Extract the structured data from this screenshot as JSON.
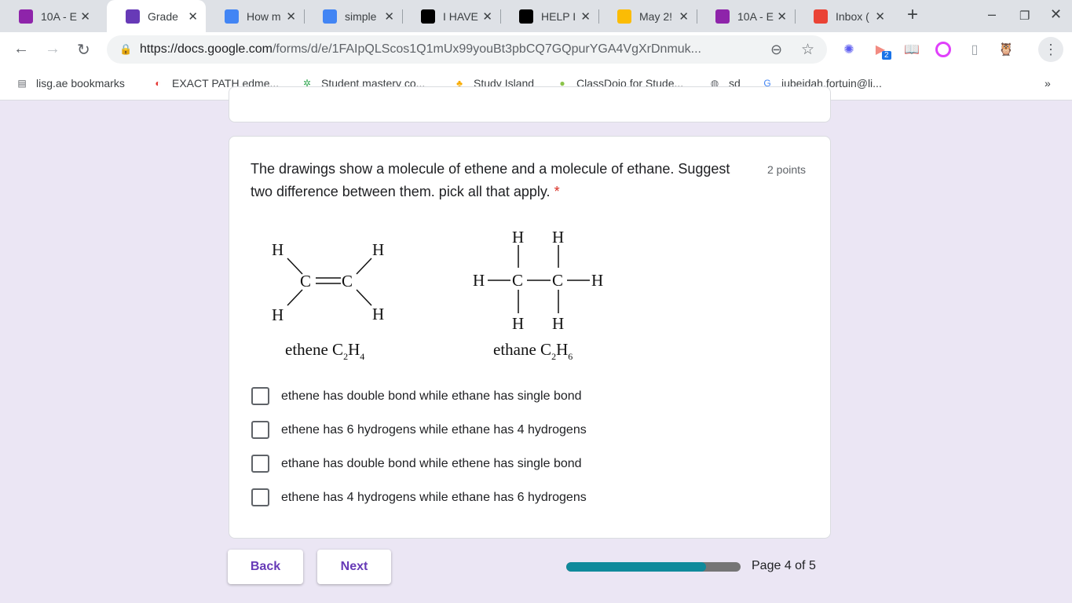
{
  "tabs": [
    {
      "title": "10A - E",
      "icon": "classroom-icon",
      "color": "#8e24aa"
    },
    {
      "title": "Grade",
      "icon": "forms-icon",
      "color": "#673ab7",
      "active": true
    },
    {
      "title": "How m",
      "icon": "google-icon",
      "color": "#4285f4"
    },
    {
      "title": "simple",
      "icon": "google-icon",
      "color": "#4285f4"
    },
    {
      "title": "I HAVE",
      "icon": "brainly-icon",
      "color": "#000000"
    },
    {
      "title": "HELP I",
      "icon": "brainly-icon",
      "color": "#000000"
    },
    {
      "title": "May 2!",
      "icon": "drive-icon",
      "color": "#fbbc04"
    },
    {
      "title": "10A - E",
      "icon": "classroom-icon",
      "color": "#8e24aa"
    },
    {
      "title": "Inbox (",
      "icon": "gmail-icon",
      "color": "#ea4335"
    }
  ],
  "url": {
    "host": "https://docs.google.com",
    "path": "/forms/d/e/1FAIpQLScos1Q1mUx99youBt3pbCQ7GQpurYGA4VgXrDnmuk..."
  },
  "extension_badge": "2",
  "bookmarks": [
    "lisg.ae bookmarks",
    "EXACT PATH edme...",
    "Student mastery co...",
    "Study Island",
    "ClassDojo for Stude...",
    "sd",
    "jubeidah.fortuin@li..."
  ],
  "question": {
    "text": "The drawings show a molecule of ethene and a molecule of ethane. Suggest two difference between them. pick all that apply.",
    "required_mark": "*",
    "points": "2 points",
    "image": {
      "atom_h": "H",
      "atom_c": "C",
      "ethene_label": "ethene C",
      "ethene_c_sub": "2",
      "ethene_h": "H",
      "ethene_h_sub": "4",
      "ethane_label": "ethane C",
      "ethane_c_sub": "2",
      "ethane_h": "H",
      "ethane_h_sub": "6"
    },
    "options": [
      {
        "label": "ethene has double bond while ethane has single bond",
        "checked": false
      },
      {
        "label": "ethene has 6 hydrogens while ethane has 4 hydrogens",
        "checked": false
      },
      {
        "label": "ethane has double bond while ethene has single bond",
        "checked": false
      },
      {
        "label": "ethene has 4 hydrogens while ethane has 6 hydrogens",
        "checked": false
      }
    ]
  },
  "footer": {
    "back": "Back",
    "next": "Next",
    "progress": 0.8,
    "page": "Page 4 of 5"
  }
}
